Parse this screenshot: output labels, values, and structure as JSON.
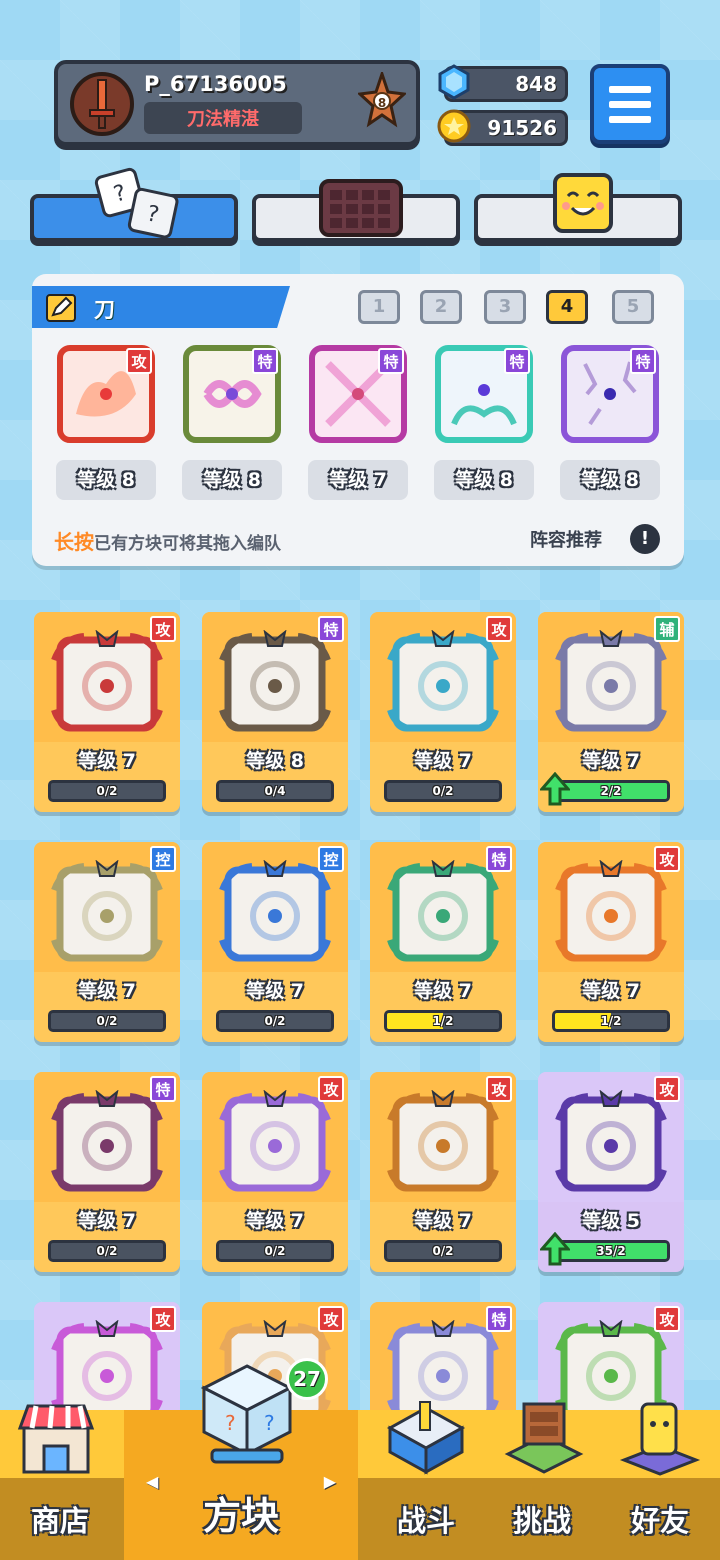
{
  "player": {
    "name": "P_67136005",
    "title": "刀法精湛",
    "rank": "8"
  },
  "currency": {
    "gems": "848",
    "coins": "91526"
  },
  "colors": {
    "attack": "#e03a3a",
    "special": "#8a47d8",
    "support": "#2fb27a",
    "control": "#2d7ae3",
    "accent": "#2e86e6"
  },
  "tabs": [
    {
      "icon": "dice-icon"
    },
    {
      "icon": "chocolate-board-icon"
    },
    {
      "icon": "smiley-cube-icon"
    }
  ],
  "team": {
    "title": "刀",
    "decks": [
      "1",
      "2",
      "3",
      "4",
      "5"
    ],
    "active_deck": "4",
    "slots": [
      {
        "tag": "攻",
        "level": "等级 8"
      },
      {
        "tag": "特",
        "level": "等级 8"
      },
      {
        "tag": "特",
        "level": "等级 7"
      },
      {
        "tag": "特",
        "level": "等级 8"
      },
      {
        "tag": "特",
        "level": "等级 8"
      }
    ],
    "hint_em": "长按",
    "hint_rest": "已有方块可将其拖入编队",
    "lineup_recommend": "阵容推荐",
    "info_symbol": "!"
  },
  "cards": [
    {
      "tag": "攻",
      "level": "等级 7",
      "progress": "0/2",
      "ratio": 0
    },
    {
      "tag": "特",
      "level": "等级 8",
      "progress": "0/4",
      "ratio": 0
    },
    {
      "tag": "攻",
      "level": "等级 7",
      "progress": "0/2",
      "ratio": 0
    },
    {
      "tag": "辅",
      "level": "等级 7",
      "progress": "2/2",
      "ratio": 1
    },
    {
      "tag": "控",
      "level": "等级 7",
      "progress": "0/2",
      "ratio": 0
    },
    {
      "tag": "控",
      "level": "等级 7",
      "progress": "0/2",
      "ratio": 0
    },
    {
      "tag": "特",
      "level": "等级 7",
      "progress": "1/2",
      "ratio": 0.5
    },
    {
      "tag": "攻",
      "level": "等级 7",
      "progress": "1/2",
      "ratio": 0.5
    },
    {
      "tag": "特",
      "level": "等级 7",
      "progress": "0/2",
      "ratio": 0
    },
    {
      "tag": "攻",
      "level": "等级 7",
      "progress": "0/2",
      "ratio": 0
    },
    {
      "tag": "攻",
      "level": "等级 7",
      "progress": "0/2",
      "ratio": 0
    },
    {
      "tag": "攻",
      "level": "等级 5",
      "progress": "35/2",
      "ratio": 1
    },
    {
      "tag": "攻"
    },
    {
      "tag": "攻"
    },
    {
      "tag": "特"
    },
    {
      "tag": "攻"
    }
  ],
  "nav": {
    "items": [
      {
        "label": "商店"
      },
      {
        "label": "方块"
      },
      {
        "label": "战斗"
      },
      {
        "label": "挑战"
      },
      {
        "label": "好友"
      }
    ],
    "badge": "27"
  }
}
